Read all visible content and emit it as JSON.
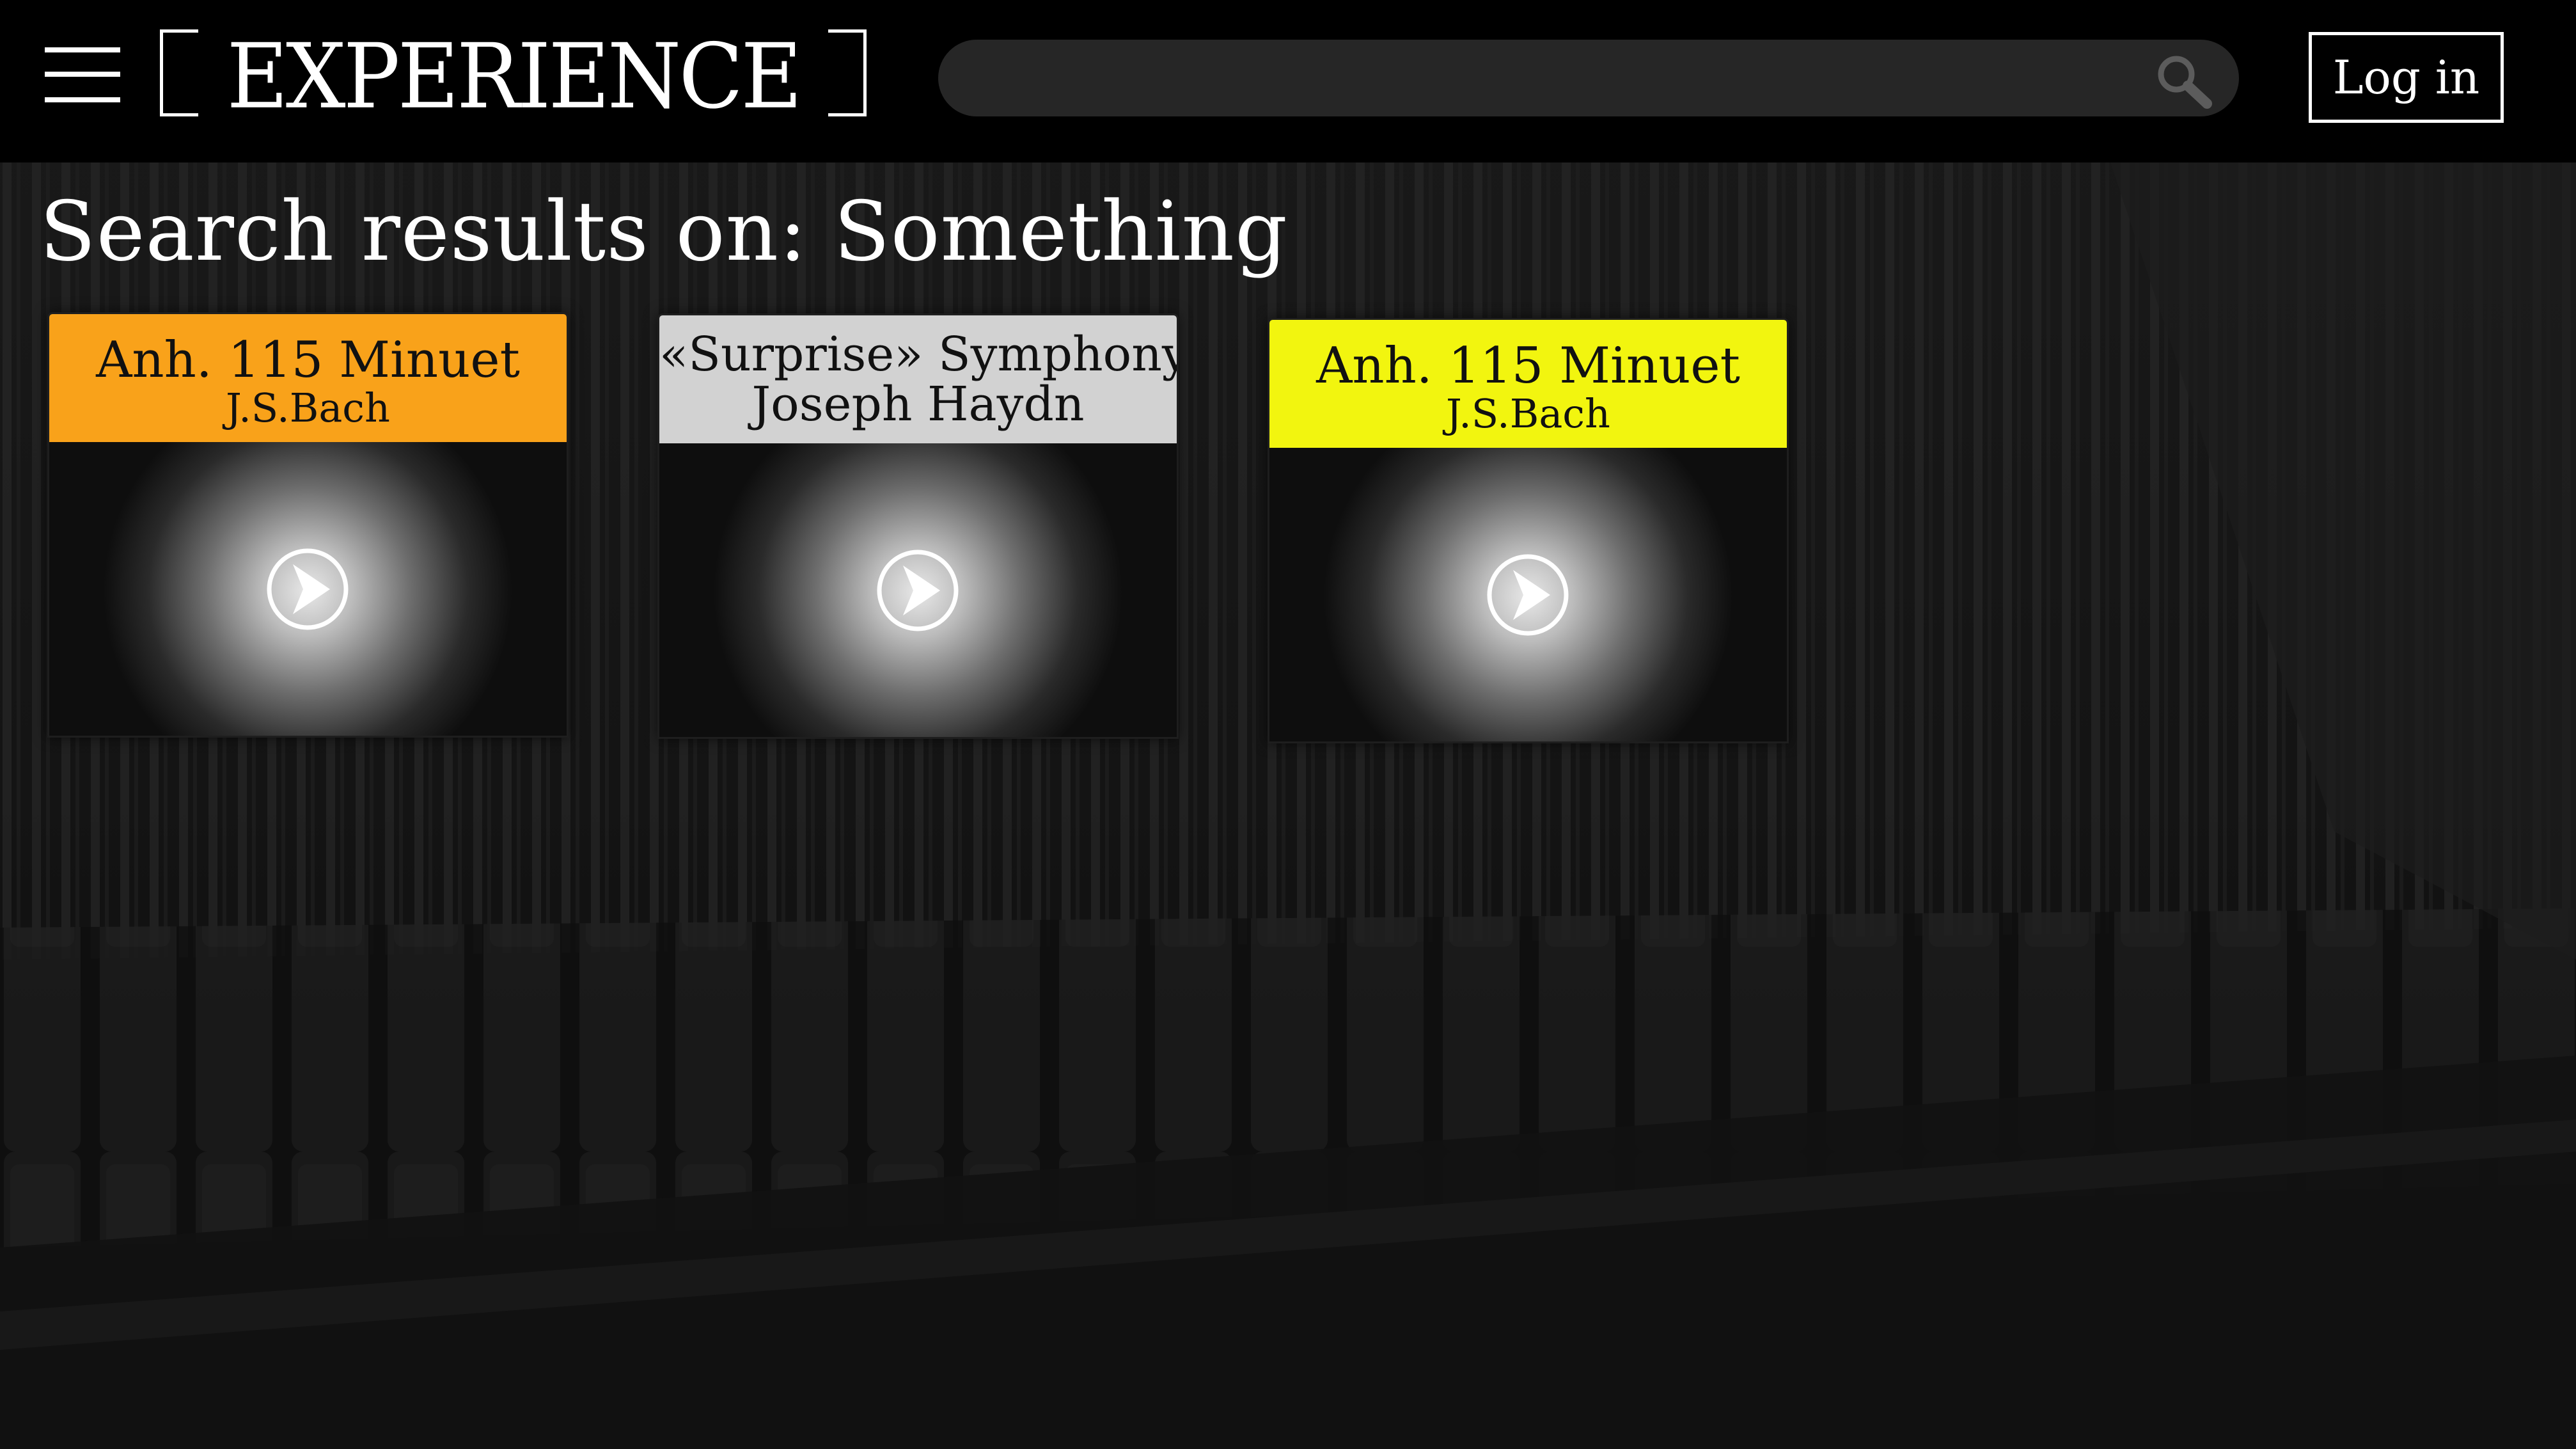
{
  "header": {
    "logo_text": "EXPERIENCE",
    "search_placeholder": "",
    "login_label": "Log in"
  },
  "results": {
    "title": "Search results on: Something",
    "cards": [
      {
        "title": "Anh. 115 Minuet",
        "composer": "J.S.Bach",
        "accent": "#f9a21a"
      },
      {
        "title": "«Surprise» Symphony",
        "composer": "Joseph Haydn",
        "accent": "#d2d2d2"
      },
      {
        "title": "Anh. 115 Minuet",
        "composer": "J.S.Bach",
        "accent": "#f2f50f"
      }
    ]
  },
  "icons": {
    "menu": "hamburger-menu-icon",
    "search": "magnifier-icon",
    "play": "play-circle-icon"
  },
  "colors": {
    "background": "#0d0d0d",
    "header": "#000000",
    "search_field": "#262626",
    "text": "#ffffff"
  }
}
